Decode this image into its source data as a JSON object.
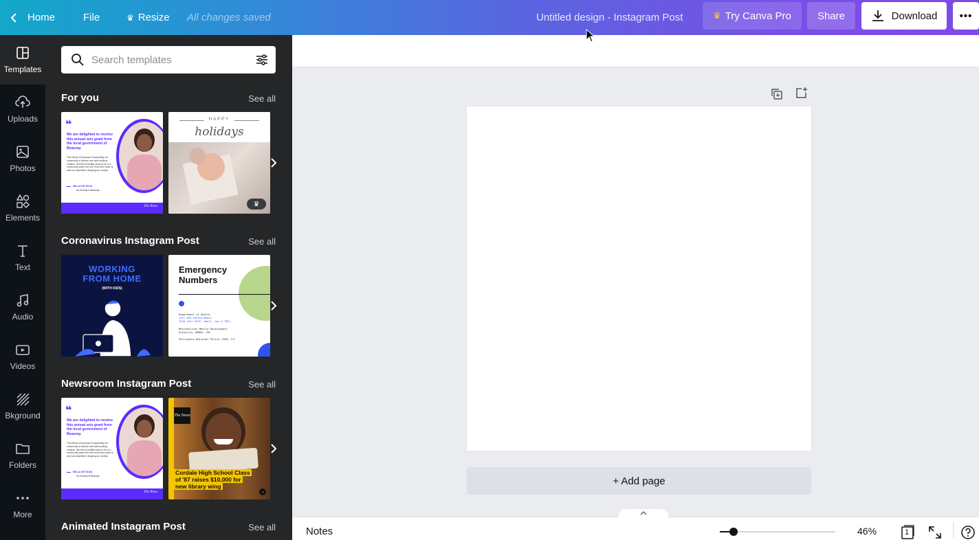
{
  "topbar": {
    "home": "Home",
    "file": "File",
    "resize": "Resize",
    "saved_status": "All changes saved",
    "document_title": "Untitled design - Instagram Post",
    "try_pro": "Try Canva Pro",
    "share": "Share",
    "download": "Download",
    "more": "•••"
  },
  "rail": {
    "items": [
      {
        "label": "Templates",
        "icon": "templates-icon",
        "active": true
      },
      {
        "label": "Uploads",
        "icon": "upload-icon"
      },
      {
        "label": "Photos",
        "icon": "photos-icon"
      },
      {
        "label": "Elements",
        "icon": "elements-icon"
      },
      {
        "label": "Text",
        "icon": "text-icon"
      },
      {
        "label": "Audio",
        "icon": "audio-icon"
      },
      {
        "label": "Videos",
        "icon": "videos-icon"
      },
      {
        "label": "Bkground",
        "icon": "background-icon"
      },
      {
        "label": "Folders",
        "icon": "folder-icon"
      },
      {
        "label": "More",
        "icon": "more-icon"
      }
    ]
  },
  "search": {
    "placeholder": "Search templates"
  },
  "sections": [
    {
      "title": "For you",
      "see_all": "See all"
    },
    {
      "title": "Coronavirus Instagram Post",
      "see_all": "See all"
    },
    {
      "title": "Newsroom Instagram Post",
      "see_all": "See all"
    },
    {
      "title": "Animated Instagram Post",
      "see_all": "See all"
    }
  ],
  "thumbs": {
    "quote": {
      "body": "We are delighted to receive this annual arts grant from the local government of Beauray.",
      "small": "This will go a long way in supporting our community of diverse and hard working creators. We feel incredibly lucky to be in a community where the role of art and music is seen as essential in shaping our society.",
      "name": "WILLA DE SILVA",
      "org": "Art Society of Beauray",
      "logo": "The News"
    },
    "holidays": {
      "top": "HAPPY",
      "script": "holidays"
    },
    "wfh": {
      "line1": "WORKING",
      "line2": "FROM HOME",
      "line3": "(WITH KIDS)"
    },
    "emergency": {
      "title1": "Emergency",
      "title2": "Numbers",
      "lines": [
        "Department of Health",
        "(02) 894-COVID(26843)",
        "1555 (For PLDT, Smart, Sun & TNT)",
        "",
        "Metropolitan Manila Development",
        "Authority (MMDA) 136",
        "",
        "Philippine National Police (PNP) 117"
      ]
    },
    "news": {
      "logo": "The News",
      "headline": "Cordale High School Class of '87 raises $10,000 for new library wing"
    }
  },
  "canvas": {
    "add_page": "+ Add page"
  },
  "bottombar": {
    "notes": "Notes",
    "zoom": "46%",
    "page_count": "1",
    "zoom_value": 0.46
  },
  "colors": {
    "accent": "#7d2ae8",
    "panel": "#252627",
    "rail": "#0e1318",
    "quote_purple": "#5b2bff"
  }
}
